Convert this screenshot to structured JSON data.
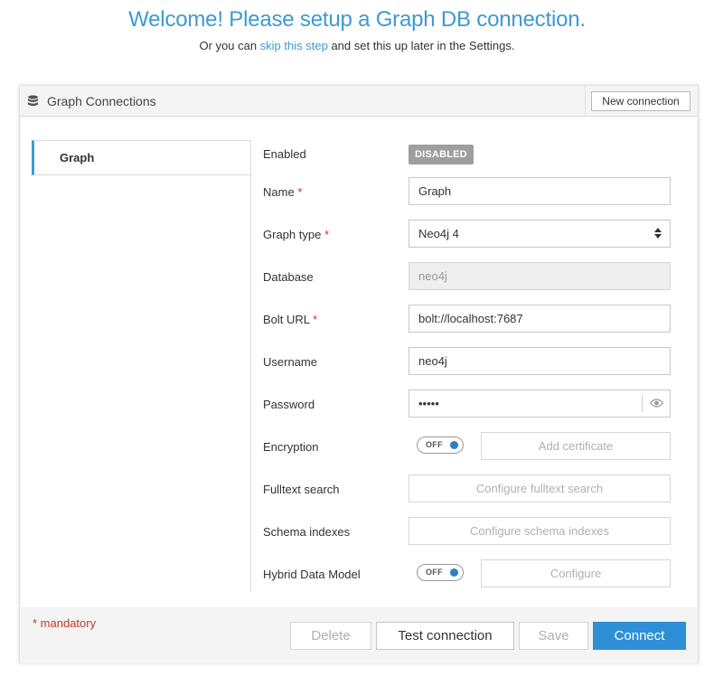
{
  "header": {
    "title": "Welcome! Please setup a Graph DB connection.",
    "sub_prefix": "Or you can ",
    "skip_link": "skip this step",
    "sub_suffix": " and set this up later in the Settings."
  },
  "panel": {
    "title": "Graph Connections",
    "new_connection_label": "New connection"
  },
  "sidebar": {
    "items": [
      {
        "label": "Graph",
        "selected": true
      }
    ]
  },
  "form": {
    "enabled": {
      "label": "Enabled",
      "status": "DISABLED"
    },
    "name": {
      "label": "Name",
      "value": "Graph",
      "required": "*"
    },
    "graph_type": {
      "label": "Graph type",
      "value": "Neo4j 4",
      "required": "*"
    },
    "database": {
      "label": "Database",
      "placeholder": "neo4j"
    },
    "bolt_url": {
      "label": "Bolt URL",
      "value": "bolt://localhost:7687",
      "required": "*"
    },
    "username": {
      "label": "Username",
      "value": "neo4j"
    },
    "password": {
      "label": "Password",
      "masked_value": "•••••"
    },
    "encryption": {
      "label": "Encryption",
      "toggle": "OFF",
      "button": "Add certificate"
    },
    "fulltext": {
      "label": "Fulltext search",
      "button": "Configure fulltext search"
    },
    "schema": {
      "label": "Schema indexes",
      "button": "Configure schema indexes"
    },
    "hybrid": {
      "label": "Hybrid Data Model",
      "toggle": "OFF",
      "button": "Configure"
    }
  },
  "footer": {
    "mandatory": "* mandatory",
    "delete": "Delete",
    "test": "Test connection",
    "save": "Save",
    "connect": "Connect"
  },
  "colors": {
    "accent": "#3d9ad1",
    "primary_button": "#2d8fd5",
    "required": "#c0392b",
    "disabled_badge": "#9e9e9e"
  },
  "icons": {
    "panel": "database-icon",
    "select": "sort-arrows-icon",
    "password": "eye-icon"
  }
}
